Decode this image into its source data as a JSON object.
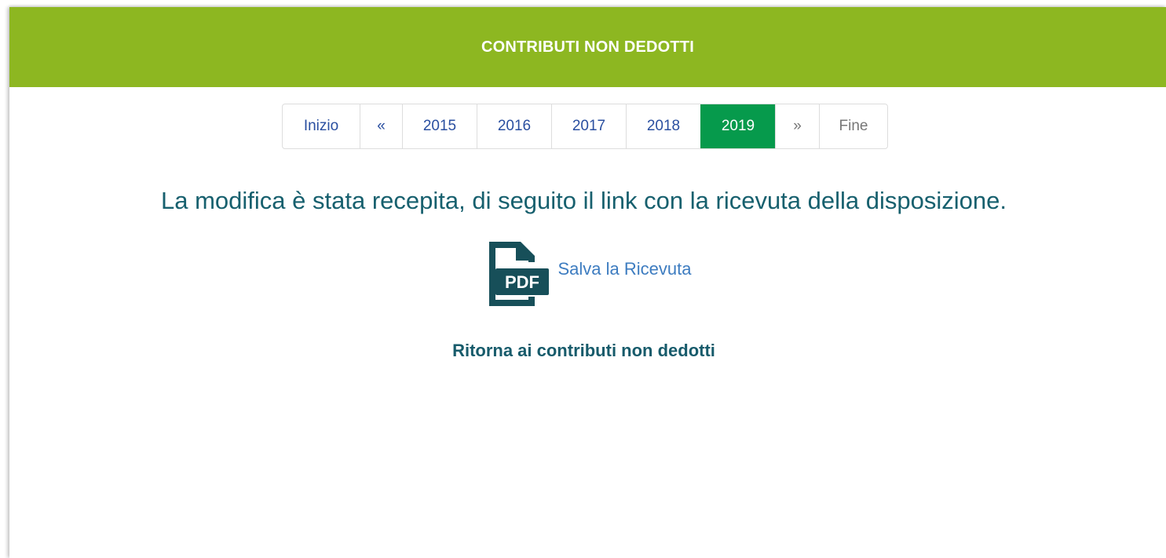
{
  "header": {
    "title": "CONTRIBUTI NON DEDOTTI",
    "background_color": "#8db721"
  },
  "pagination": {
    "first_label": "Inizio",
    "prev_label": "«",
    "years": [
      "2015",
      "2016",
      "2017",
      "2018",
      "2019"
    ],
    "active_year": "2019",
    "next_label": "»",
    "last_label": "Fine",
    "active_color": "#069a4c"
  },
  "message": {
    "text": "La modifica è stata recepita, di seguito il link con la ricevuta della disposizione."
  },
  "receipt": {
    "icon": "pdf-file-icon",
    "icon_text": "PDF",
    "link_label": "Salva la Ricevuta"
  },
  "back_link": {
    "label": "Ritorna ai contributi non dedotti"
  }
}
